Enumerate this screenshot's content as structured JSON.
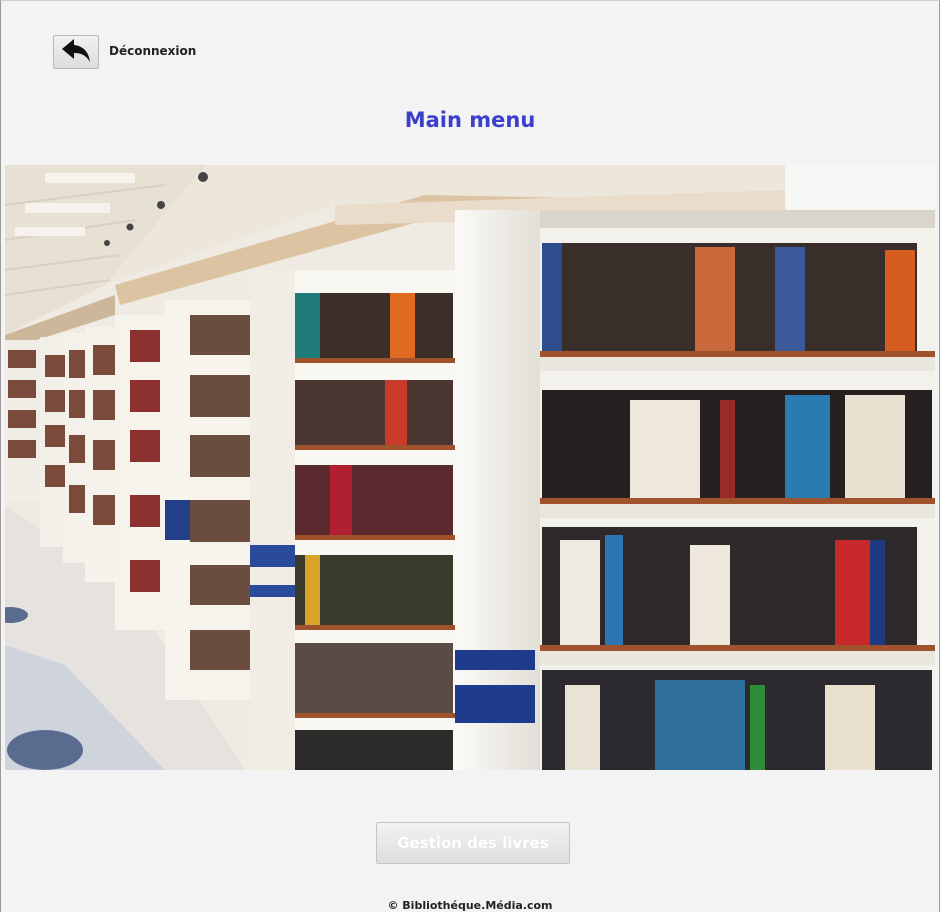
{
  "header": {
    "logout_label": "Déconnexion",
    "logout_icon": "reply-arrow-icon"
  },
  "title": "Main menu",
  "hero": {
    "image_description_icon": "library-bookshelves-photo"
  },
  "actions": {
    "books_button_label": "Gestion des livres"
  },
  "footer": {
    "copyright": "© Bibliothéque.Média.com"
  },
  "colors": {
    "title": "#3b3ecf",
    "background": "#f3f3f3",
    "button_text": "#ffffff"
  }
}
